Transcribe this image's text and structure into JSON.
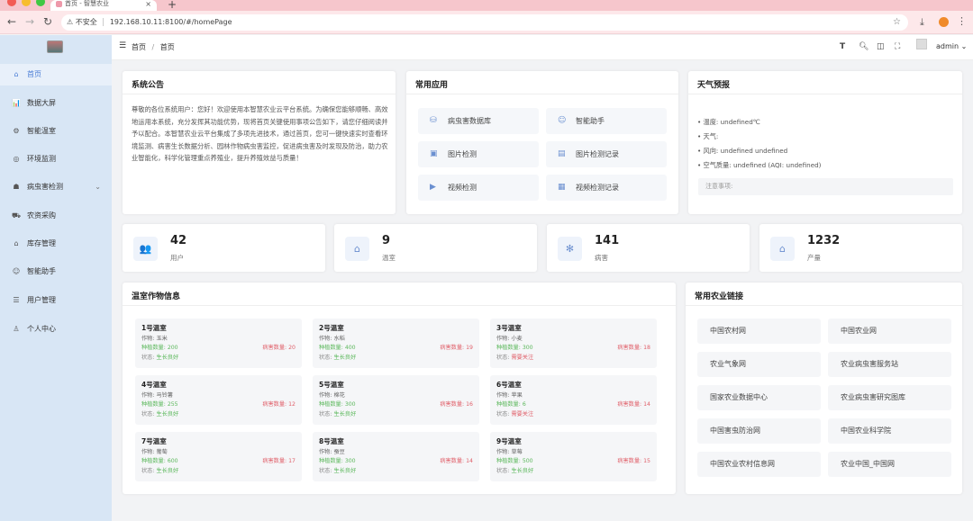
{
  "browser": {
    "tab_title": "首页 - 智慧农业",
    "address": "192.168.10.11:8100/#/homePage",
    "insecure_label": "不安全"
  },
  "sidebar": {
    "items": [
      {
        "label": "首页",
        "icon": "home-icon",
        "glyph": "⌂"
      },
      {
        "label": "数据大屏",
        "icon": "chart-icon",
        "glyph": "📊"
      },
      {
        "label": "智能温室",
        "icon": "greenhouse-icon",
        "glyph": "⚙"
      },
      {
        "label": "环境监测",
        "icon": "monitor-icon",
        "glyph": "◎"
      },
      {
        "label": "病虫害检测",
        "icon": "bug-icon",
        "glyph": "☗"
      },
      {
        "label": "农资采购",
        "icon": "cart-icon",
        "glyph": "⛟"
      },
      {
        "label": "库存管理",
        "icon": "warehouse-icon",
        "glyph": "⌂"
      },
      {
        "label": "智能助手",
        "icon": "robot-icon",
        "glyph": "☺"
      },
      {
        "label": "用户管理",
        "icon": "users-icon",
        "glyph": "☰"
      },
      {
        "label": "个人中心",
        "icon": "user-icon",
        "glyph": "♙"
      }
    ]
  },
  "header": {
    "breadcrumb": [
      "首页",
      "首页"
    ],
    "user": "admin"
  },
  "notice": {
    "title": "系统公告",
    "text": "尊敬的各位系统用户：您好！欢迎使用本智慧农业云平台系统。为确保您能够顺畅、高效地运用本系统，充分发挥其功能优势，现将首页关键使用事项公告如下，请您仔细阅读并予以配合。本智慧农业云平台集成了多项先进技术，通过首页，您可一键快速实时查看环境监测、病害生长数据分析、园林作物病虫害监控，促进病虫害及时发现及防治，助力农业智能化，科学化管理重点养殖业，提升养殖效益与质量！"
  },
  "apps": {
    "title": "常用应用",
    "items": [
      {
        "label": "病虫害数据库",
        "glyph": "⛁"
      },
      {
        "label": "智能助手",
        "glyph": "☺"
      },
      {
        "label": "图片检测",
        "glyph": "▣"
      },
      {
        "label": "图片检测记录",
        "glyph": "▤"
      },
      {
        "label": "视频检测",
        "glyph": "▶"
      },
      {
        "label": "视频检测记录",
        "glyph": "▦"
      }
    ]
  },
  "weather": {
    "title": "天气预报",
    "lines": [
      "温度: undefined℃",
      "天气:",
      "风向: undefined undefined",
      "空气质量: undefined (AQI: undefined)"
    ],
    "note": "注意事项:"
  },
  "stats": [
    {
      "value": "42",
      "label": "用户",
      "glyph": "👥"
    },
    {
      "value": "9",
      "label": "温室",
      "glyph": "⌂"
    },
    {
      "value": "141",
      "label": "病害",
      "glyph": "✻"
    },
    {
      "value": "1232",
      "label": "产量",
      "glyph": "⌂"
    }
  ],
  "greenhouses": {
    "title": "温室作物信息",
    "crop_key": "作物:",
    "plant_key": "种植数量:",
    "pest_key": "病害数量:",
    "status_key": "状态:",
    "items": [
      {
        "name": "1号温室",
        "crop": "玉米",
        "plant": "200",
        "pest": "20",
        "status": "生长良好",
        "status_color": "#5cb85c"
      },
      {
        "name": "2号温室",
        "crop": "水稻",
        "plant": "400",
        "pest": "19",
        "status": "生长良好",
        "status_color": "#5cb85c"
      },
      {
        "name": "3号温室",
        "crop": "小麦",
        "plant": "300",
        "pest": "18",
        "status": "需要关注",
        "status_color": "#e0606a"
      },
      {
        "name": "4号温室",
        "crop": "马铃薯",
        "plant": "255",
        "pest": "12",
        "status": "生长良好",
        "status_color": "#5cb85c"
      },
      {
        "name": "5号温室",
        "crop": "棉花",
        "plant": "300",
        "pest": "16",
        "status": "生长良好",
        "status_color": "#5cb85c"
      },
      {
        "name": "6号温室",
        "crop": "苹果",
        "plant": "6",
        "pest": "14",
        "status": "需要关注",
        "status_color": "#e0606a"
      },
      {
        "name": "7号温室",
        "crop": "葡萄",
        "plant": "600",
        "pest": "17",
        "status": "生长良好",
        "status_color": "#5cb85c"
      },
      {
        "name": "8号温室",
        "crop": "蚕豆",
        "plant": "300",
        "pest": "14",
        "status": "生长良好",
        "status_color": "#5cb85c"
      },
      {
        "name": "9号温室",
        "crop": "草莓",
        "plant": "500",
        "pest": "15",
        "status": "生长良好",
        "status_color": "#5cb85c"
      }
    ]
  },
  "links": {
    "title": "常用农业链接",
    "items": [
      "中国农村网",
      "中国农业网",
      "农业气象网",
      "农业病虫害服务站",
      "国家农业数据中心",
      "农业病虫害研究图库",
      "中国害虫防治网",
      "中国农业科学院",
      "中国农业农村信息网",
      "农业中国_中国网"
    ]
  },
  "colors": {
    "accent": "#4a7dd6",
    "sidebar_bg": "#d8e6f5",
    "good": "#5cb85c",
    "warn": "#e0606a"
  }
}
